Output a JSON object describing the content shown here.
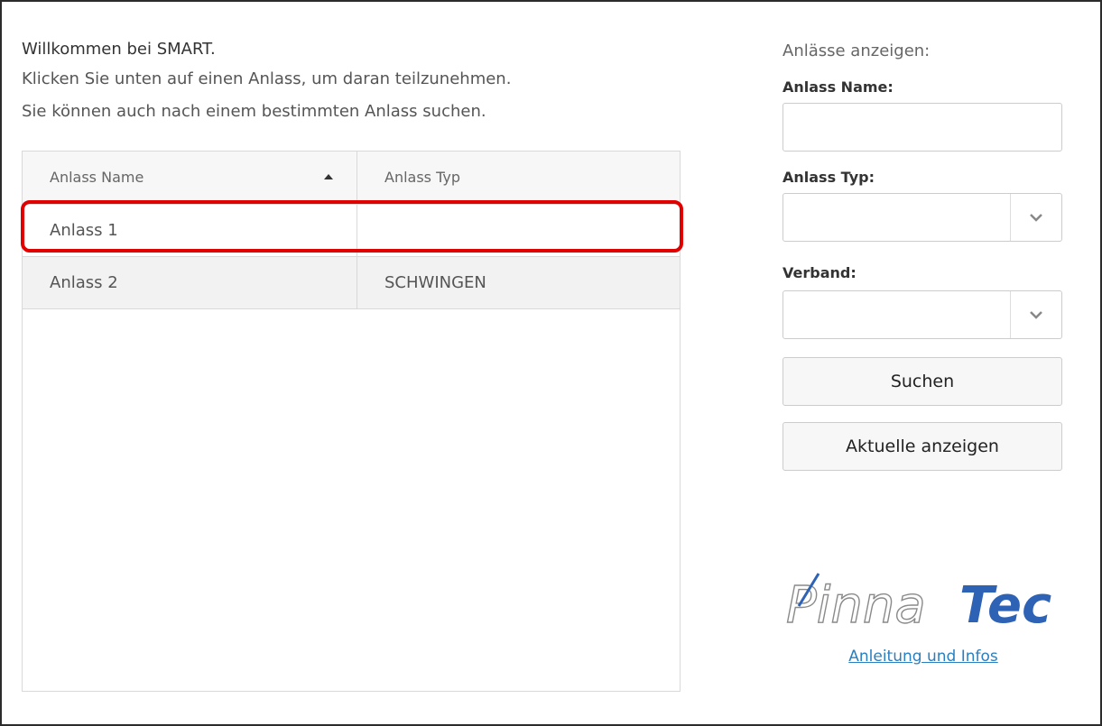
{
  "intro": {
    "welcome": "Willkommen bei SMART.",
    "line1": "Klicken Sie unten auf einen Anlass, um daran teilzunehmen.",
    "line2": "Sie können auch nach einem bestimmten Anlass suchen."
  },
  "table": {
    "headers": {
      "name": "Anlass Name",
      "type": "Anlass Typ"
    },
    "sort": {
      "column": "name",
      "direction": "ascending"
    },
    "rows": [
      {
        "name": "Anlass 1",
        "type": ""
      },
      {
        "name": "Anlass 2",
        "type": "SCHWINGEN"
      }
    ]
  },
  "filter": {
    "title": "Anlässe anzeigen:",
    "name_label": "Anlass Name:",
    "name_value": "",
    "type_label": "Anlass Typ:",
    "type_value": "",
    "verband_label": "Verband:",
    "verband_value": "",
    "search_button": "Suchen",
    "current_button": "Aktuelle anzeigen"
  },
  "logo": {
    "text_left": "Pinna",
    "text_right": "Tec"
  },
  "link": {
    "label": "Anleitung und Infos"
  },
  "colors": {
    "highlight": "#e00000",
    "link": "#2a7fc1",
    "logo_blue": "#2e62b5"
  },
  "icons": {
    "sort": "sort-ascending-icon",
    "dropdown": "chevron-down-icon"
  }
}
